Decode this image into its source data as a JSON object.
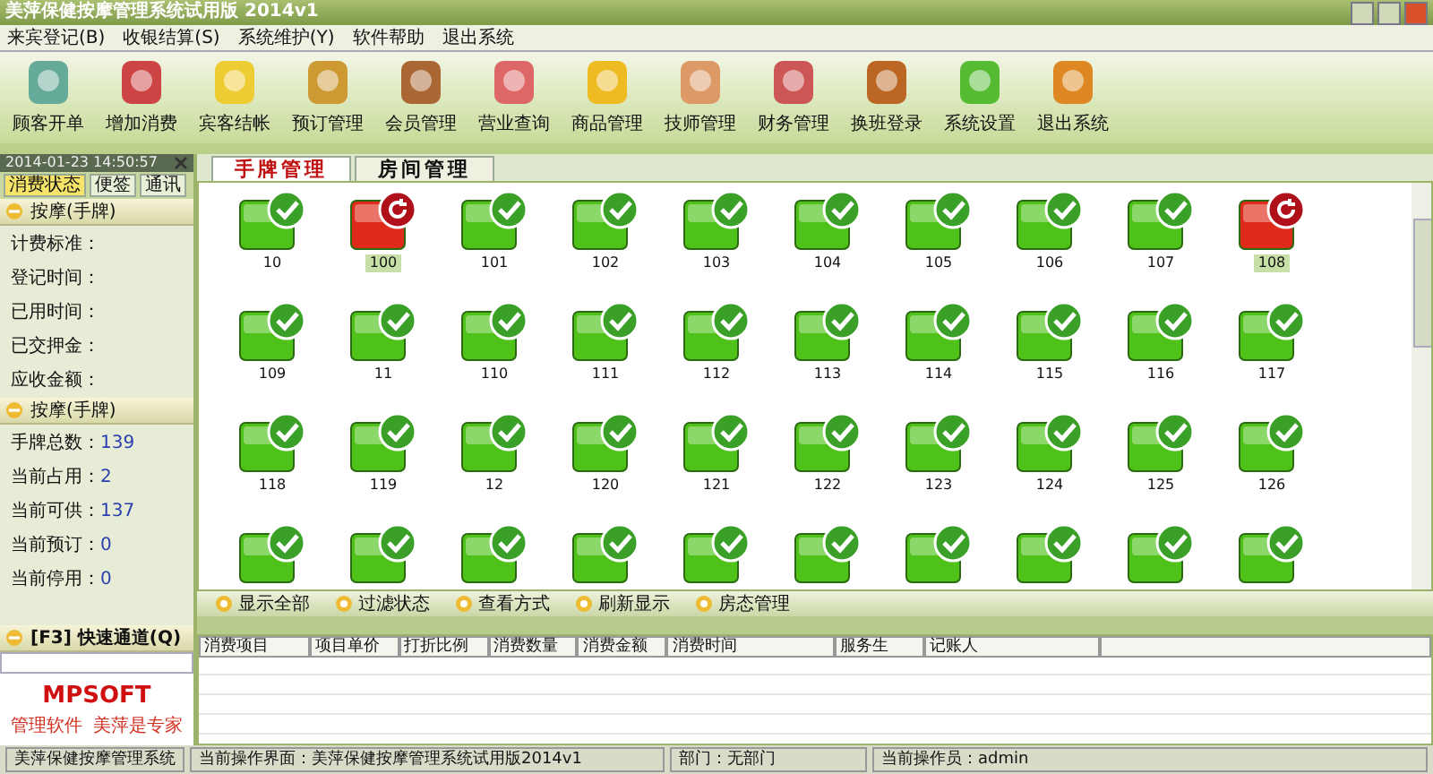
{
  "window": {
    "title": "美萍保健按摩管理系统试用版 2014v1"
  },
  "menu": [
    "来宾登记(B)",
    "收银结算(S)",
    "系统维护(Y)",
    "软件帮助",
    "退出系统"
  ],
  "toolbar": [
    {
      "label": "顾客开单"
    },
    {
      "label": "增加消费"
    },
    {
      "label": "宾客结帐"
    },
    {
      "label": "预订管理"
    },
    {
      "label": "会员管理"
    },
    {
      "label": "营业查询"
    },
    {
      "label": "商品管理"
    },
    {
      "label": "技师管理"
    },
    {
      "label": "财务管理"
    },
    {
      "label": "换班登录"
    },
    {
      "label": "系统设置"
    },
    {
      "label": "退出系统"
    }
  ],
  "sidebar": {
    "datetime": "2014-01-23 14:50:57",
    "tabs": [
      {
        "label": "消费状态",
        "selected": true
      },
      {
        "label": "便签",
        "selected": false
      },
      {
        "label": "通讯",
        "selected": false
      }
    ],
    "sections": [
      {
        "title": "按摩(手牌)",
        "fields": [
          {
            "label": "计费标准："
          },
          {
            "label": "登记时间："
          },
          {
            "label": "已用时间："
          },
          {
            "label": "已交押金："
          },
          {
            "label": "应收金额："
          }
        ]
      },
      {
        "title": "按摩(手牌)",
        "fields": [
          {
            "label": "手牌总数：",
            "value": "139"
          },
          {
            "label": "当前占用：",
            "value": "2"
          },
          {
            "label": "当前可供：",
            "value": "137"
          },
          {
            "label": "当前预订：",
            "value": "0"
          },
          {
            "label": "当前停用：",
            "value": "0"
          }
        ]
      }
    ],
    "quick": {
      "title": "[F3] 快速通道(Q)"
    },
    "logo": "MPSOFT",
    "slogan": "管理软件  美萍是专家"
  },
  "tabs": [
    {
      "label": "手牌管理",
      "selected": true
    },
    {
      "label": "房间管理",
      "selected": false
    }
  ],
  "tiles": [
    {
      "label": "10",
      "kind": "free"
    },
    {
      "label": "100",
      "kind": "busy"
    },
    {
      "label": "101",
      "kind": "free"
    },
    {
      "label": "102",
      "kind": "free"
    },
    {
      "label": "103",
      "kind": "free"
    },
    {
      "label": "104",
      "kind": "free"
    },
    {
      "label": "105",
      "kind": "free"
    },
    {
      "label": "106",
      "kind": "free"
    },
    {
      "label": "107",
      "kind": "free"
    },
    {
      "label": "108",
      "kind": "busy"
    },
    {
      "label": "109",
      "kind": "free"
    },
    {
      "label": "11",
      "kind": "free"
    },
    {
      "label": "110",
      "kind": "free"
    },
    {
      "label": "111",
      "kind": "free"
    },
    {
      "label": "112",
      "kind": "free"
    },
    {
      "label": "113",
      "kind": "free"
    },
    {
      "label": "114",
      "kind": "free"
    },
    {
      "label": "115",
      "kind": "free"
    },
    {
      "label": "116",
      "kind": "free"
    },
    {
      "label": "117",
      "kind": "free"
    },
    {
      "label": "118",
      "kind": "free"
    },
    {
      "label": "119",
      "kind": "free"
    },
    {
      "label": "12",
      "kind": "free"
    },
    {
      "label": "120",
      "kind": "free"
    },
    {
      "label": "121",
      "kind": "free"
    },
    {
      "label": "122",
      "kind": "free"
    },
    {
      "label": "123",
      "kind": "free"
    },
    {
      "label": "124",
      "kind": "free"
    },
    {
      "label": "125",
      "kind": "free"
    },
    {
      "label": "126",
      "kind": "free"
    },
    {
      "kind": "free"
    },
    {
      "kind": "free"
    },
    {
      "kind": "free"
    },
    {
      "kind": "free"
    },
    {
      "kind": "free"
    },
    {
      "kind": "free"
    },
    {
      "kind": "free"
    },
    {
      "kind": "free"
    },
    {
      "kind": "free"
    },
    {
      "kind": "free"
    }
  ],
  "actions": [
    "显示全部",
    "过滤状态",
    "查看方式",
    "刷新显示",
    "房态管理"
  ],
  "table": {
    "columns": [
      "消费项目",
      "项目单价",
      "打折比例",
      "消费数量",
      "消费金额",
      "消费时间",
      "服务生",
      "记账人"
    ]
  },
  "status_bar": [
    "美萍保健按摩管理系统",
    "当前操作界面：美萍保健按摩管理系统试用版2014v1",
    "部门：无部门",
    "当前操作员：admin"
  ]
}
